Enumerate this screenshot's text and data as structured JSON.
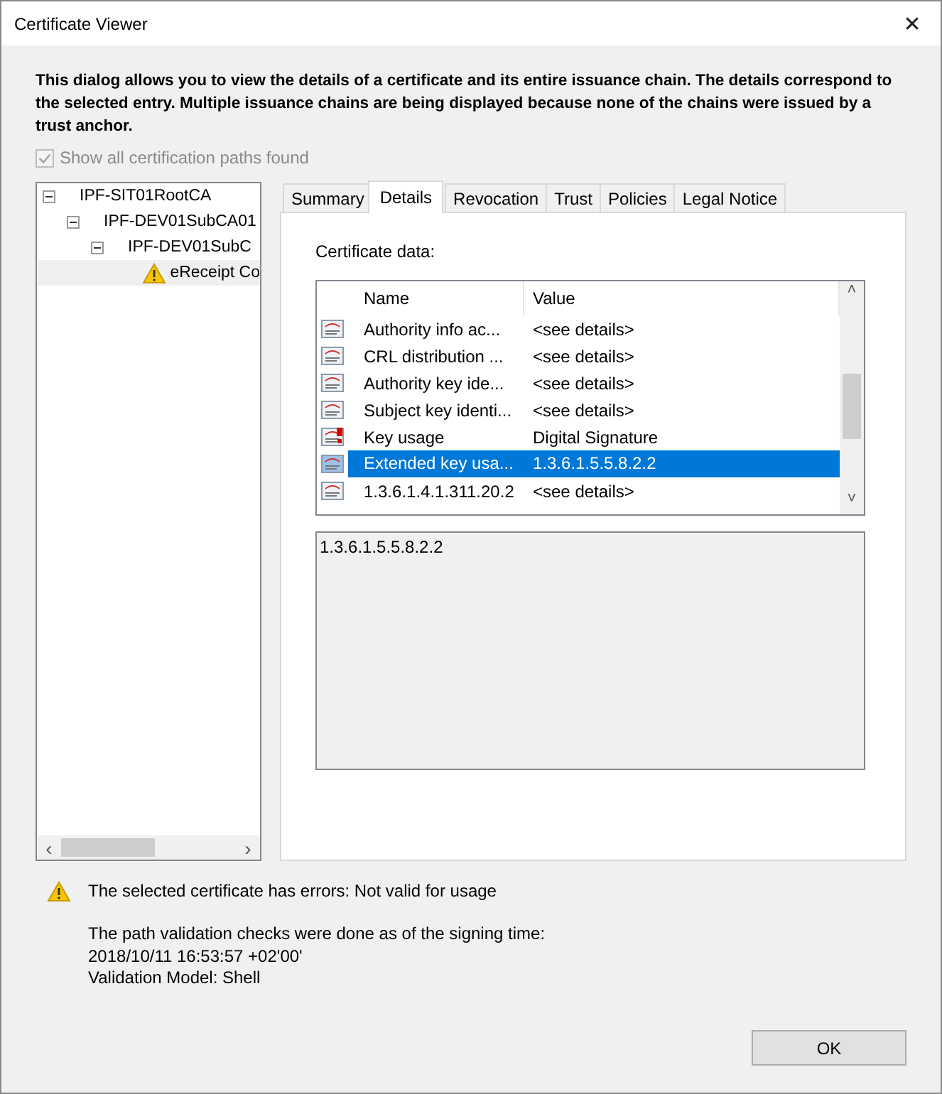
{
  "window": {
    "title": "Certificate Viewer",
    "close": "✕"
  },
  "intro": "This dialog allows you to view the details of a certificate and its entire issuance chain. The details correspond to the selected entry. Multiple issuance chains are being displayed because none of the chains were issued by a trust anchor.",
  "show_all_paths": {
    "label": "Show all certification paths found",
    "checked": true,
    "disabled": true
  },
  "tree": [
    {
      "label": "IPF-SIT01RootCA",
      "expanded": true,
      "selected": false,
      "children": [
        {
          "label": "IPF-DEV01SubCA01",
          "expanded": true,
          "selected": false,
          "children": [
            {
              "label": "IPF-DEV01SubC",
              "expanded": true,
              "selected": false,
              "children": [
                {
                  "label": "eReceipt Co",
                  "selected": true,
                  "warning": true
                }
              ]
            }
          ]
        }
      ]
    }
  ],
  "tree_scroll": {
    "left": "‹",
    "right": "›"
  },
  "tabs": [
    {
      "label": "Summary",
      "selected": false
    },
    {
      "label": "Details",
      "selected": true
    },
    {
      "label": "Revocation",
      "selected": false
    },
    {
      "label": "Trust",
      "selected": false
    },
    {
      "label": "Policies",
      "selected": false
    },
    {
      "label": "Legal Notice",
      "selected": false
    }
  ],
  "details": {
    "label": "Certificate data:",
    "columns": [
      "Name",
      "Value"
    ],
    "rows": [
      {
        "kind": "extension",
        "name": "Authority info ac...",
        "value": "<see details>",
        "selected": false
      },
      {
        "kind": "extension",
        "name": "CRL distribution ...",
        "value": "<see details>",
        "selected": false
      },
      {
        "kind": "extension",
        "name": "Authority key ide...",
        "value": "<see details>",
        "selected": false
      },
      {
        "kind": "extension",
        "name": "Subject key identi...",
        "value": "<see details>",
        "selected": false
      },
      {
        "kind": "critical",
        "name": "Key usage",
        "value": "Digital Signature",
        "selected": false
      },
      {
        "kind": "extension",
        "name": "Extended key usa...",
        "value": "1.3.6.1.5.5.8.2.2",
        "selected": true
      },
      {
        "kind": "extension",
        "name": "1.3.6.1.4.1.311.20.2",
        "value": "<see details>",
        "selected": false
      }
    ],
    "scroll": {
      "up": "˄",
      "down": "˅"
    },
    "value_text": "1.3.6.1.5.5.8.2.2"
  },
  "status": {
    "error": "The selected certificate has errors: Not valid for usage",
    "lines": [
      "The path validation checks were done as of the signing time:",
      "2018/10/11 16:53:57 +02'00'",
      "Validation Model: Shell"
    ]
  },
  "buttons": [
    "OK"
  ]
}
